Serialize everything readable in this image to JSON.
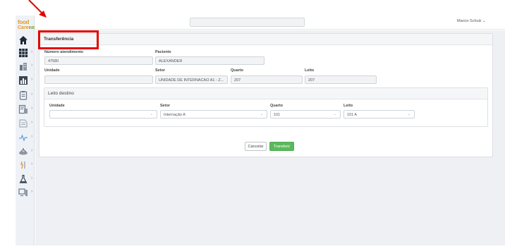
{
  "app": {
    "logo_line1": "food",
    "logo_line2": "Care",
    "logo_suffix": "INB"
  },
  "topbar": {
    "user_label": "Marcio Schulz ⌄"
  },
  "panel": {
    "title": "Transferência"
  },
  "form": {
    "numero_atendimento_label": "Número atendimento",
    "numero_atendimento_value": "47580",
    "paciente_label": "Paciente",
    "paciente_value": "ALEXANDER",
    "unidade_label": "Unidade",
    "unidade_value": "",
    "setor_label": "Setor",
    "setor_value": "UNIDADE DE INTERNACAO A1 - Z...",
    "quarto_label": "Quarto",
    "quarto_value": "207",
    "leito_label": "Leito",
    "leito_value": "207"
  },
  "destino": {
    "title": "Leito destino",
    "unidade_label": "Unidade",
    "unidade_value": "",
    "setor_label": "Setor",
    "setor_value": "Internação A",
    "quarto_label": "Quarto",
    "quarto_value": "101",
    "leito_label": "Leito",
    "leito_value": "101 A"
  },
  "actions": {
    "cancel_label": "Cancelar",
    "transfer_label": "Transferir"
  },
  "colors": {
    "accent_green": "#5cb85c",
    "highlight_red": "#e10600",
    "logo_orange": "#e29a2a"
  },
  "sidebar": {
    "items": [
      {
        "icon": "home-icon"
      },
      {
        "icon": "grid-icon"
      },
      {
        "icon": "building-icon"
      },
      {
        "icon": "chart-icon"
      },
      {
        "icon": "clipboard-icon"
      },
      {
        "icon": "report-icon"
      },
      {
        "icon": "document-icon"
      },
      {
        "icon": "pulse-icon"
      },
      {
        "icon": "tray-icon"
      },
      {
        "icon": "chef-icon"
      },
      {
        "icon": "flask-icon"
      },
      {
        "icon": "screen-icon"
      }
    ]
  }
}
